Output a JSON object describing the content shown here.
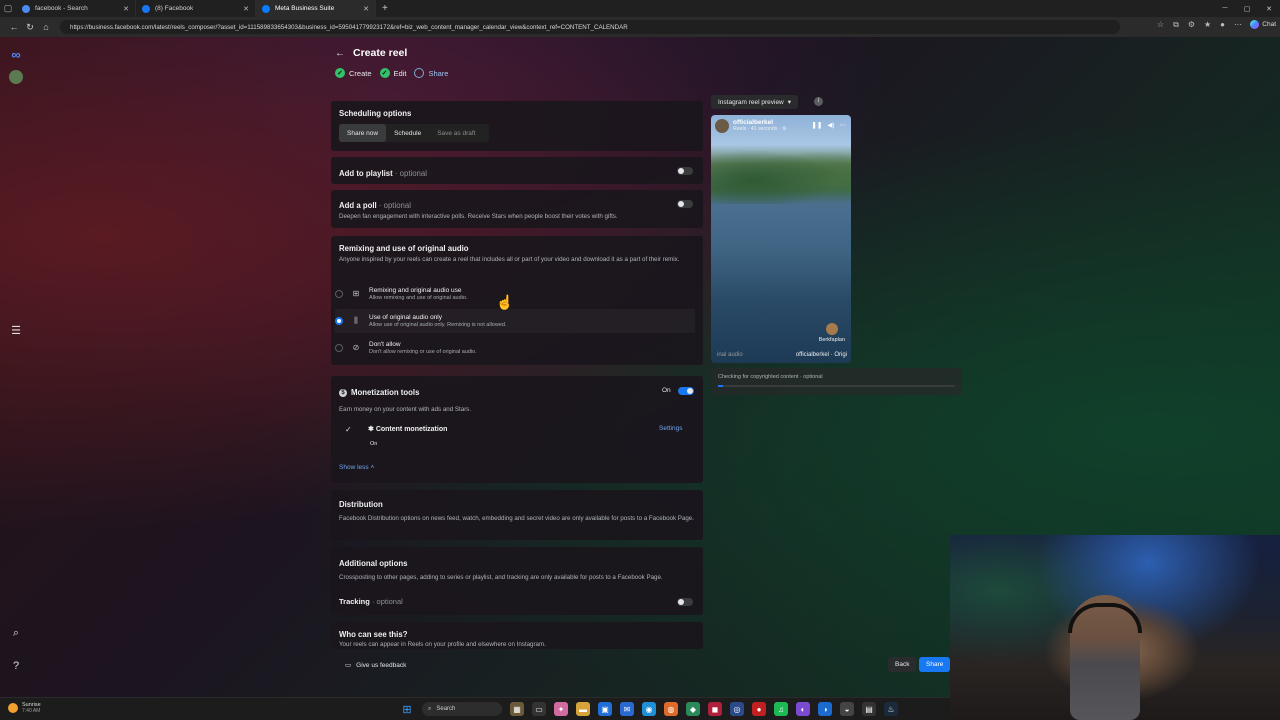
{
  "browser": {
    "tabs": [
      {
        "title": "facebook - Search",
        "active": false,
        "color": "#4a8cf0"
      },
      {
        "title": "(8) Facebook",
        "active": false,
        "color": "#1877f2"
      },
      {
        "title": "Meta Business Suite",
        "active": true,
        "color": "#0a7cff"
      }
    ],
    "url": "https://business.facebook.com/latest/reels_composer/?asset_id=111589833654303&business_id=595041779923172&ref=biz_web_content_manager_calendar_view&context_ref=CONTENT_CALENDAR",
    "chat_label": "Chat"
  },
  "page": {
    "title": "Create reel",
    "steps": [
      {
        "label": "Create",
        "state": "done"
      },
      {
        "label": "Edit",
        "state": "done"
      },
      {
        "label": "Share",
        "state": "current"
      }
    ]
  },
  "scheduling": {
    "title": "Scheduling options",
    "options": [
      "Share now",
      "Schedule",
      "Save as draft"
    ],
    "selected": "Share now"
  },
  "playlist": {
    "title": "Add to playlist",
    "optional": "· optional",
    "enabled": false
  },
  "poll": {
    "title": "Add a poll",
    "optional": "· optional",
    "description": "Deepen fan engagement with interactive polls. Receive Stars when people boost their votes with gifts.",
    "enabled": false
  },
  "remix": {
    "title": "Remixing and use of original audio",
    "description": "Anyone inspired by your reels can create a reel that includes all or part of your video and download it as a part of their remix.",
    "options": [
      {
        "title": "Remixing and original audio use",
        "desc": "Allow remixing and use of original audio.",
        "selected": false
      },
      {
        "title": "Use of original audio only",
        "desc": "Allow use of original audio only. Remixing is not allowed.",
        "selected": true
      },
      {
        "title": "Don't allow",
        "desc": "Don't allow remixing or use of original audio.",
        "selected": false
      }
    ]
  },
  "monetization": {
    "title": "Monetization tools",
    "state": "On",
    "enabled": true,
    "description": "Earn money on your content with ads and Stars.",
    "item_title": "Content monetization",
    "item_state": "On",
    "settings_label": "Settings",
    "show_less": "Show less"
  },
  "distribution": {
    "title": "Distribution",
    "description": "Facebook Distribution options on news feed, watch, embedding and secret video are only available for posts to a Facebook Page."
  },
  "additional": {
    "title": "Additional options",
    "description": "Crossposting to other pages, adding to series or playlist, and tracking are only available for posts to a Facebook Page.",
    "tracking": "Tracking",
    "tracking_optional": "· optional"
  },
  "visibility": {
    "title": "Who can see this?",
    "description": "Your reels can appear in Reels on your profile and elsewhere on Instagram."
  },
  "footer": {
    "feedback": "Give us feedback",
    "back": "Back",
    "share": "Share"
  },
  "preview": {
    "label": "Instagram reel preview",
    "username": "officialberkel",
    "meta": "Reels · 41 seconds · ⚙",
    "audio_left": "inal audio",
    "audio_right": "officialberkel · Origi",
    "user_tag": "Berkfaplan",
    "copyright": "Checking for copyrighted content · optional"
  },
  "taskbar": {
    "weather_title": "Sunrise",
    "weather_time": "7:40 AM",
    "search": "Search"
  }
}
